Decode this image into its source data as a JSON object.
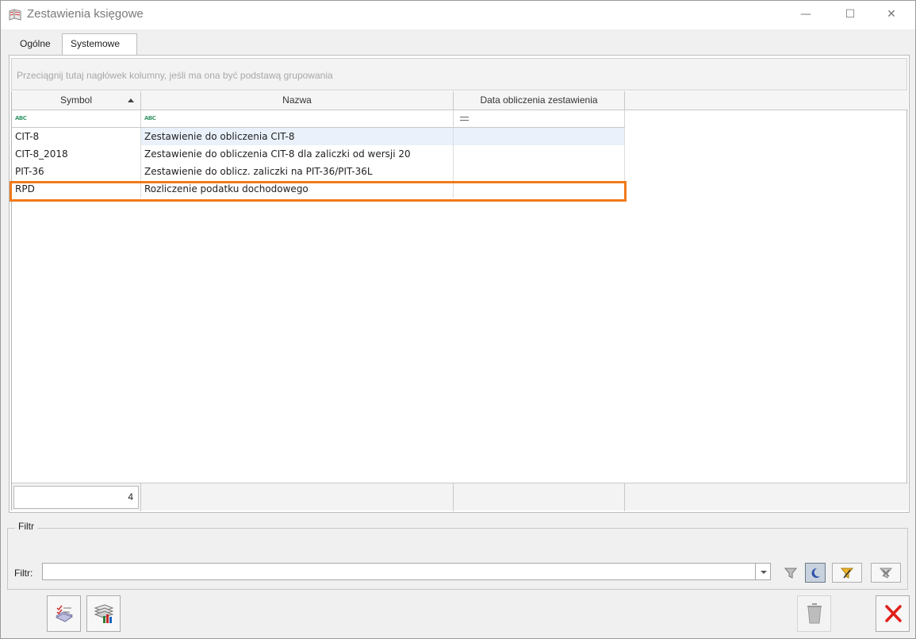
{
  "window": {
    "title": "Zestawienia księgowe",
    "minimize": "—",
    "maximize": "☐",
    "close": "✕"
  },
  "tabs": [
    {
      "label": "Ogólne",
      "active": false
    },
    {
      "label": "Systemowe",
      "active": true
    }
  ],
  "grid": {
    "group_hint": "Przeciągnij tutaj nagłówek kolumny, jeśli ma ona być podstawą grupowania",
    "columns": [
      "Symbol",
      "Nazwa",
      "Data obliczenia zestawienia"
    ],
    "sort_column": "Symbol",
    "filter_icons": [
      "abc-icon",
      "abc-icon",
      "equals-icon"
    ],
    "filter_abc_text": "ABC",
    "rows": [
      {
        "symbol": "CIT-8",
        "nazwa": "Zestawienie do obliczenia CIT-8",
        "data": ""
      },
      {
        "symbol": "CIT-8_2018",
        "nazwa": "Zestawienie do obliczenia CIT-8 dla zaliczki od wersji 20",
        "data": ""
      },
      {
        "symbol": "PIT-36",
        "nazwa": "Zestawienie do oblicz. zaliczki na PIT-36/PIT-36L",
        "data": ""
      },
      {
        "symbol": "RPD",
        "nazwa": "Rozliczenie podatku dochodowego",
        "data": ""
      }
    ],
    "selected_row_index": 0,
    "highlighted_row_index": 3,
    "highlight_color": "#f07a1a",
    "count": "4"
  },
  "filter": {
    "group_label": "Filtr",
    "label": "Filtr:",
    "value": ""
  },
  "buttons": {
    "filter_buttons": [
      "funnel-icon",
      "moon-filter-icon",
      "funnel-edit-icon",
      "funnel-clear-icon"
    ],
    "bottom_left": [
      "accounting-list-icon",
      "books-icon"
    ],
    "bottom_right": [
      "trash-icon",
      "close-x-icon"
    ]
  },
  "colors": {
    "selection": "#eaf1fb",
    "close_red": "#e0201a"
  }
}
